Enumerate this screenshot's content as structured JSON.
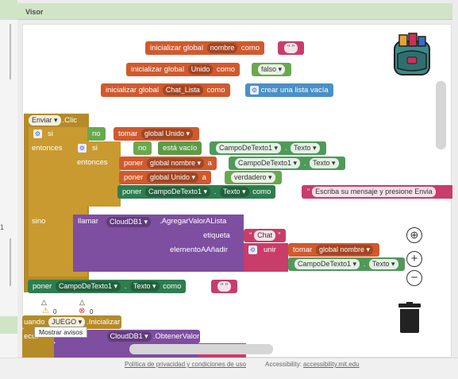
{
  "panel": {
    "title": "Visor"
  },
  "side_number": "1",
  "blocks": {
    "nombre": {
      "pre": "inicializar global",
      "name": "nombre",
      "post": "como",
      "value": "\" \""
    },
    "unido": {
      "pre": "inicializar global",
      "name": "Unido",
      "post": "como",
      "value": "falso"
    },
    "chat": {
      "pre": "inicializar global",
      "name": "Chat_Lista",
      "post": "como",
      "value": "crear una lista vacía"
    },
    "event": {
      "component": "Enviar",
      "event": ".Clic"
    },
    "if1": {
      "si": "si",
      "no": "no",
      "tomar": "tomar",
      "var": "global Unido",
      "entonces": "entonces",
      "sino": "sino"
    },
    "if2": {
      "si": "si",
      "no": "no",
      "estavacio": "está vacío",
      "comp": "CampoDeTexto1",
      "prop": "Texto",
      "entonces": "entonces"
    },
    "poner1": {
      "poner": "poner",
      "var": "global nombre",
      "a": "a",
      "comp": "CampoDeTexto1",
      "prop": "Texto"
    },
    "poner2": {
      "poner": "poner",
      "var": "global Unido",
      "a": "a",
      "val": "verdadero"
    },
    "poner3": {
      "poner": "poner",
      "comp": "CampoDeTexto1",
      "prop": "Texto",
      "como": "como",
      "val": "Escriba su mensaje y presione Envia"
    },
    "llamar": {
      "llamar": "llamar",
      "comp": "CloudDB1",
      "method": ".AgregarValorALista",
      "etiqueta": "etiqueta",
      "etiqueta_val": "Chat",
      "elemento": "elementoAAñadir",
      "unir": "unir",
      "tomar": "tomar",
      "var": "global nombre",
      "comp2": "CampoDeTexto1",
      "prop": "Texto"
    },
    "poner4": {
      "poner": "poner",
      "comp": "CampoDeTexto1",
      "prop": "Texto",
      "como": "como",
      "val": "\" \""
    },
    "cuando": {
      "text": "uando",
      "comp": "JUEGO",
      "event": ".Inicializar"
    },
    "ejecutar": {
      "text": "ecut",
      "comp": "CloudDB1",
      "method": ".ObtenerValor"
    }
  },
  "warnings": {
    "warn_count": "0",
    "error_count": "0",
    "tooltip": "Mostrar avisos"
  },
  "footer": {
    "privacy": "Política de privacidad y condiciones de uso",
    "access_label": "Accessibility:",
    "access_link": "accessibility.mit.edu"
  },
  "colors": {
    "variable": "#d05a2e",
    "logic": "#6aa84f",
    "text": "#2e7d4f",
    "control": "#b58b28",
    "procedure": "#7e4ea0",
    "string": "#c83d6a",
    "list": "#4a90c8"
  }
}
